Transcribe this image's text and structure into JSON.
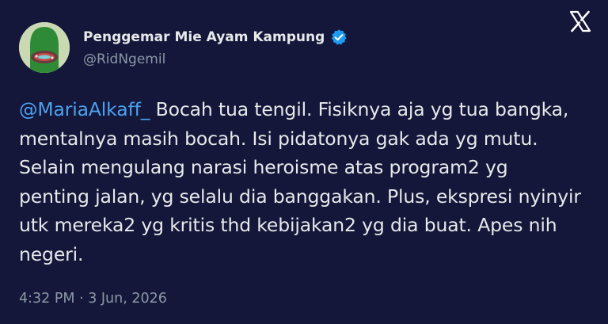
{
  "user": {
    "display_name": "Penggemar Mie Ayam Kampung",
    "handle": "@RidNgemil",
    "verified_icon": "verified-badge-icon"
  },
  "tweet": {
    "mention": "@MariaAlkaff_",
    "lines": [
      " Bocah tua tengil. Fisiknya aja yg tua bangka,",
      "mentalnya masih bocah. Isi pidatonya gak ada yg mutu.",
      "Selain mengulang narasi heroisme atas program2 yg",
      "penting jalan, yg selalu dia banggakan. Plus, ekspresi nyinyir",
      "utk mereka2 yg kritis thd kebijakan2 yg dia buat. Apes nih",
      "negeri."
    ],
    "timestamp": "4:32 PM · 3 Jun, 2026"
  },
  "colors": {
    "background": "#14173a",
    "text": "#e7e9ea",
    "muted": "#8b98a5",
    "link": "#4ca2ef",
    "verified": "#1d9bf0"
  },
  "icons": {
    "close": "x-logo-close-icon",
    "avatar": "avatar"
  }
}
